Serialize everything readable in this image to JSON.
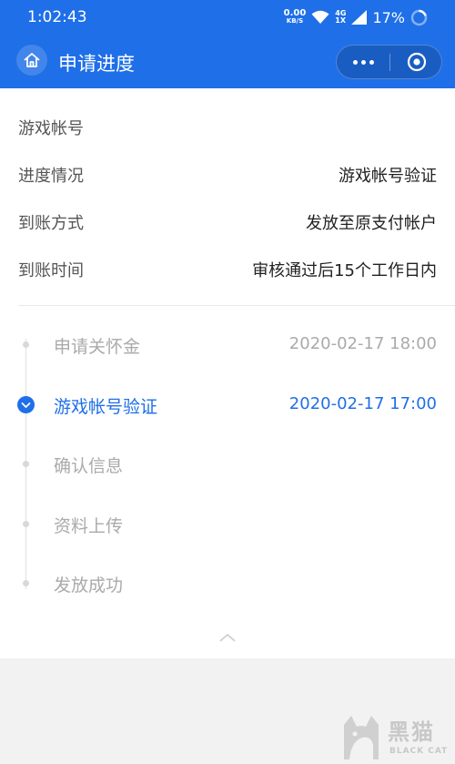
{
  "status_bar": {
    "time": "1:02:43",
    "net_speed": "0.00",
    "net_unit": "KB/S",
    "network_top": "4G",
    "network_bottom": "1X",
    "battery": "17%"
  },
  "nav": {
    "title": "申请进度",
    "icons": {
      "home": "home-icon",
      "more": "more-icon",
      "close": "target-close-icon"
    }
  },
  "info": {
    "rows": [
      {
        "label": "游戏帐号",
        "value": ""
      },
      {
        "label": "进度情况",
        "value": "游戏帐号验证"
      },
      {
        "label": "到账方式",
        "value": "发放至原支付帐户"
      },
      {
        "label": "到账时间",
        "value": "审核通过后15个工作日内"
      }
    ]
  },
  "timeline": {
    "steps": [
      {
        "name": "申请关怀金",
        "time": "2020-02-17 18:00",
        "state": "done"
      },
      {
        "name": "游戏帐号验证",
        "time": "2020-02-17 17:00",
        "state": "active"
      },
      {
        "name": "确认信息",
        "time": "",
        "state": "pending"
      },
      {
        "name": "资料上传",
        "time": "",
        "state": "pending"
      },
      {
        "name": "发放成功",
        "time": "",
        "state": "pending"
      }
    ]
  },
  "watermark": {
    "cn": "黑猫",
    "en": "BLACK CAT"
  },
  "colors": {
    "primary": "#1f6fe8",
    "inactive": "#aaaaaa",
    "background": "#f2f2f2"
  }
}
